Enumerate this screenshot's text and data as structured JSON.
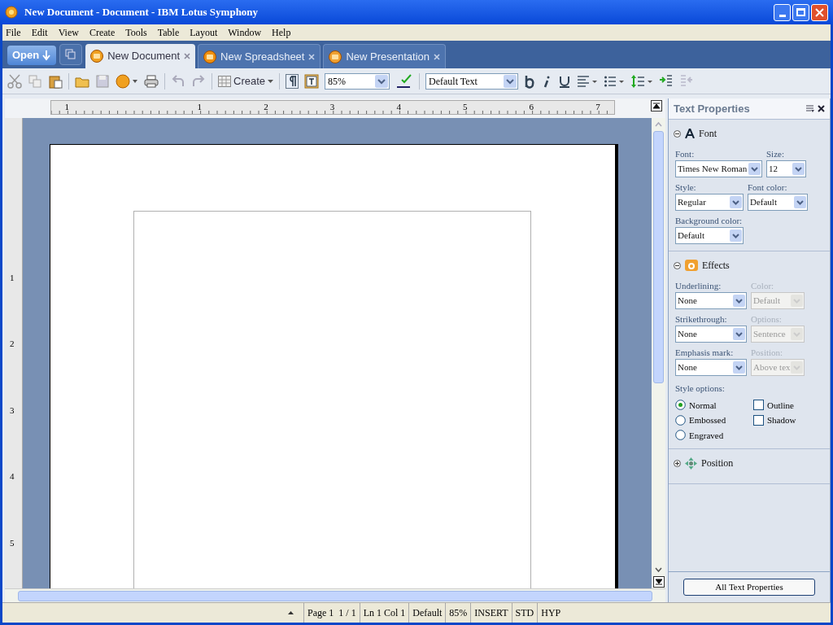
{
  "window": {
    "title": "New Document - Document - IBM Lotus Symphony"
  },
  "menu": [
    "File",
    "Edit",
    "View",
    "Create",
    "Tools",
    "Table",
    "Layout",
    "Window",
    "Help"
  ],
  "open_button": "Open",
  "tabs": [
    {
      "label": "New Document",
      "selected": true,
      "kind": "document"
    },
    {
      "label": "New Spreadsheet",
      "selected": false,
      "kind": "spreadsheet"
    },
    {
      "label": "New Presentation",
      "selected": false,
      "kind": "presentation"
    }
  ],
  "toolbar": {
    "create": "Create",
    "zoom": "85%",
    "paragraph_style": "Default Text"
  },
  "ruler": {
    "horizontal": [
      "1",
      "1",
      "2",
      "3",
      "4",
      "5",
      "6",
      "7"
    ],
    "vertical": [
      "1",
      "2",
      "3",
      "4",
      "5"
    ]
  },
  "panel": {
    "title": "Text Properties",
    "sections": [
      {
        "title": "Font",
        "kind": "font",
        "expanded": true,
        "rows": [
          [
            {
              "label": "Font:",
              "value": "Times New Roman",
              "disabled": false
            },
            {
              "label": "Size:",
              "value": "12",
              "disabled": false
            }
          ],
          [
            {
              "label": "Style:",
              "value": "Regular",
              "disabled": false
            },
            {
              "label": "Font color:",
              "value": "Default",
              "disabled": false
            }
          ],
          [
            {
              "label": "Background color:",
              "value": "Default",
              "disabled": false
            }
          ]
        ]
      },
      {
        "title": "Effects",
        "kind": "effects",
        "expanded": true,
        "rows": [
          [
            {
              "label": "Underlining:",
              "value": "None",
              "disabled": false
            },
            {
              "label": "Color:",
              "value": "Default",
              "disabled": true
            }
          ],
          [
            {
              "label": "Strikethrough:",
              "value": "None",
              "disabled": false
            },
            {
              "label": "Options:",
              "value": "Sentence",
              "disabled": true
            }
          ],
          [
            {
              "label": "Emphasis mark:",
              "value": "None",
              "disabled": false
            },
            {
              "label": "Position:",
              "value": "Above tex",
              "disabled": true
            }
          ]
        ],
        "options_label": "Style options:",
        "radios": [
          {
            "label": "Normal",
            "selected": true
          },
          {
            "label": "Embossed",
            "selected": false
          },
          {
            "label": "Engraved",
            "selected": false
          }
        ],
        "checkboxes": [
          {
            "label": "Outline",
            "checked": false
          },
          {
            "label": "Shadow",
            "checked": false
          }
        ]
      },
      {
        "title": "Position",
        "kind": "position",
        "expanded": false
      }
    ],
    "button": "All Text Properties"
  },
  "status_bar": [
    "Page 1  1 / 1",
    "Ln 1 Col 1",
    "Default",
    "85%",
    "INSERT",
    "STD",
    "HYP"
  ]
}
